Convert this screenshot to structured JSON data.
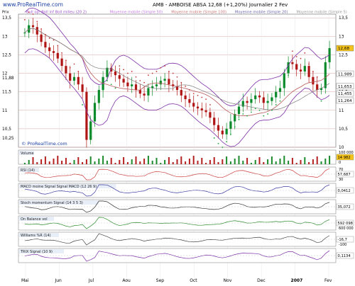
{
  "header": {
    "site": "www.ProRealTime.com",
    "title": "AMB - AMBOISE ABSA   12,68 (+1,20%)   Journalier  2 Fev"
  },
  "legend": [
    {
      "label": "Prix",
      "color": "#000000"
    },
    {
      "label": "Bull op: Boll inf Boll milieu (20 2)",
      "color": "#9b4fc9"
    },
    {
      "label": "Moyenne mobile (Simple 50)",
      "color": "#c47ae0"
    },
    {
      "label": "Moyenne mobile (Simple 100)",
      "color": "#c77"
    },
    {
      "label": "Moyenne mobile (Simple 20)",
      "color": "#66a"
    },
    {
      "label": "Moyenne mobile (Simple 5)",
      "color": "#999"
    }
  ],
  "watermark": "© ProRealTime.com",
  "chart_data": {
    "type": "candlestick",
    "x_labels": [
      "Mai",
      "Jun",
      "Jul",
      "Aou",
      "Sep",
      "Oct",
      "Nov",
      "Dec",
      "2007",
      "Fev"
    ],
    "y_ticks_left": [
      "13,5",
      "13",
      "12,5",
      "12",
      "11,88",
      "11,5",
      "11",
      "10,5",
      "10,25"
    ],
    "y_ticks_right": [
      "13,5",
      "13",
      "12,5",
      "12",
      "11,5",
      "11",
      "10,5",
      "10"
    ],
    "ylim": [
      10.0,
      13.6
    ],
    "right_flags": [
      {
        "value": "12,68",
        "price": 12.68,
        "color": "#f3c21b"
      },
      {
        "value": "11,989",
        "price": 11.99,
        "color": "#ffffff"
      },
      {
        "value": "11,653",
        "price": 11.65,
        "color": "#ffffff"
      },
      {
        "value": "11,455",
        "price": 11.455,
        "color": "#ffffff"
      },
      {
        "value": "11,264",
        "price": 11.264,
        "color": "#ffffff"
      }
    ],
    "close": [
      13.1,
      13.3,
      13.25,
      13.05,
      12.85,
      12.7,
      12.6,
      12.55,
      12.4,
      12.2,
      12.0,
      11.8,
      11.9,
      11.7,
      11.5,
      10.2,
      10.7,
      11.2,
      11.55,
      11.9,
      12.15,
      12.05,
      11.95,
      11.85,
      11.75,
      11.65,
      11.7,
      11.55,
      11.45,
      11.4,
      11.6,
      11.65,
      11.7,
      11.8,
      11.85,
      11.7,
      11.65,
      11.55,
      11.4,
      11.3,
      11.2,
      11.1,
      11.05,
      11.0,
      10.95,
      10.8,
      10.6,
      10.45,
      10.35,
      10.5,
      10.7,
      10.9,
      11.1,
      11.25,
      11.2,
      11.3,
      11.4,
      11.35,
      11.2,
      11.25,
      11.35,
      11.5,
      11.6,
      12.0,
      12.3,
      12.25,
      12.1,
      12.05,
      12.2,
      11.9,
      11.7,
      11.55,
      11.6,
      12.3,
      12.68
    ],
    "panels": [
      {
        "name": "Volume",
        "value": "14 982",
        "max_label": "100 000",
        "zero_label": "0"
      },
      {
        "name": "RSI (14)",
        "value": "57,687",
        "max_label": "70",
        "zero_label": "30"
      },
      {
        "name": "MACD moine Signal Signal MACD (12 26 9)",
        "value": "0,0412",
        "max_label": "",
        "zero_label": ""
      },
      {
        "name": "Stoch momentum Signal (14 3 5 3)",
        "value": "35,072",
        "max_label": "",
        "zero_label": ""
      },
      {
        "name": "On Balance vol",
        "value": "592 098",
        "max_label": "",
        "zero_label": "600 000"
      },
      {
        "name": "Williams %R (14)",
        "value": "-16,7",
        "max_label": "",
        "zero_label": "-100"
      },
      {
        "name": "TRIX Signal (10 9)",
        "value": "0,1134",
        "max_label": "",
        "zero_label": ""
      }
    ]
  }
}
